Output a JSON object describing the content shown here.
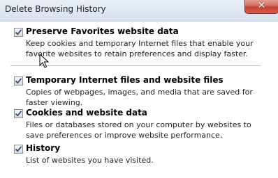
{
  "window": {
    "title": "Delete Browsing History",
    "close_glyph": "✕"
  },
  "options": [
    {
      "title": "Preserve Favorites website data",
      "description": "Keep cookies and temporary Internet files that enable your favorite websites to retain preferences and display faster.",
      "checked": true
    },
    {
      "title": "Temporary Internet files and website files",
      "description": "Copies of webpages, images, and media that are saved for faster viewing.",
      "checked": true
    },
    {
      "title": "Cookies and website data",
      "description": "Files or databases stored on your computer by websites to save preferences or improve website performance.",
      "checked": true
    },
    {
      "title": "History",
      "description": "List of websites you have visited.",
      "checked": true
    }
  ],
  "colors": {
    "close_button": "#c4412d",
    "checkmark": "#2b4e7e"
  }
}
